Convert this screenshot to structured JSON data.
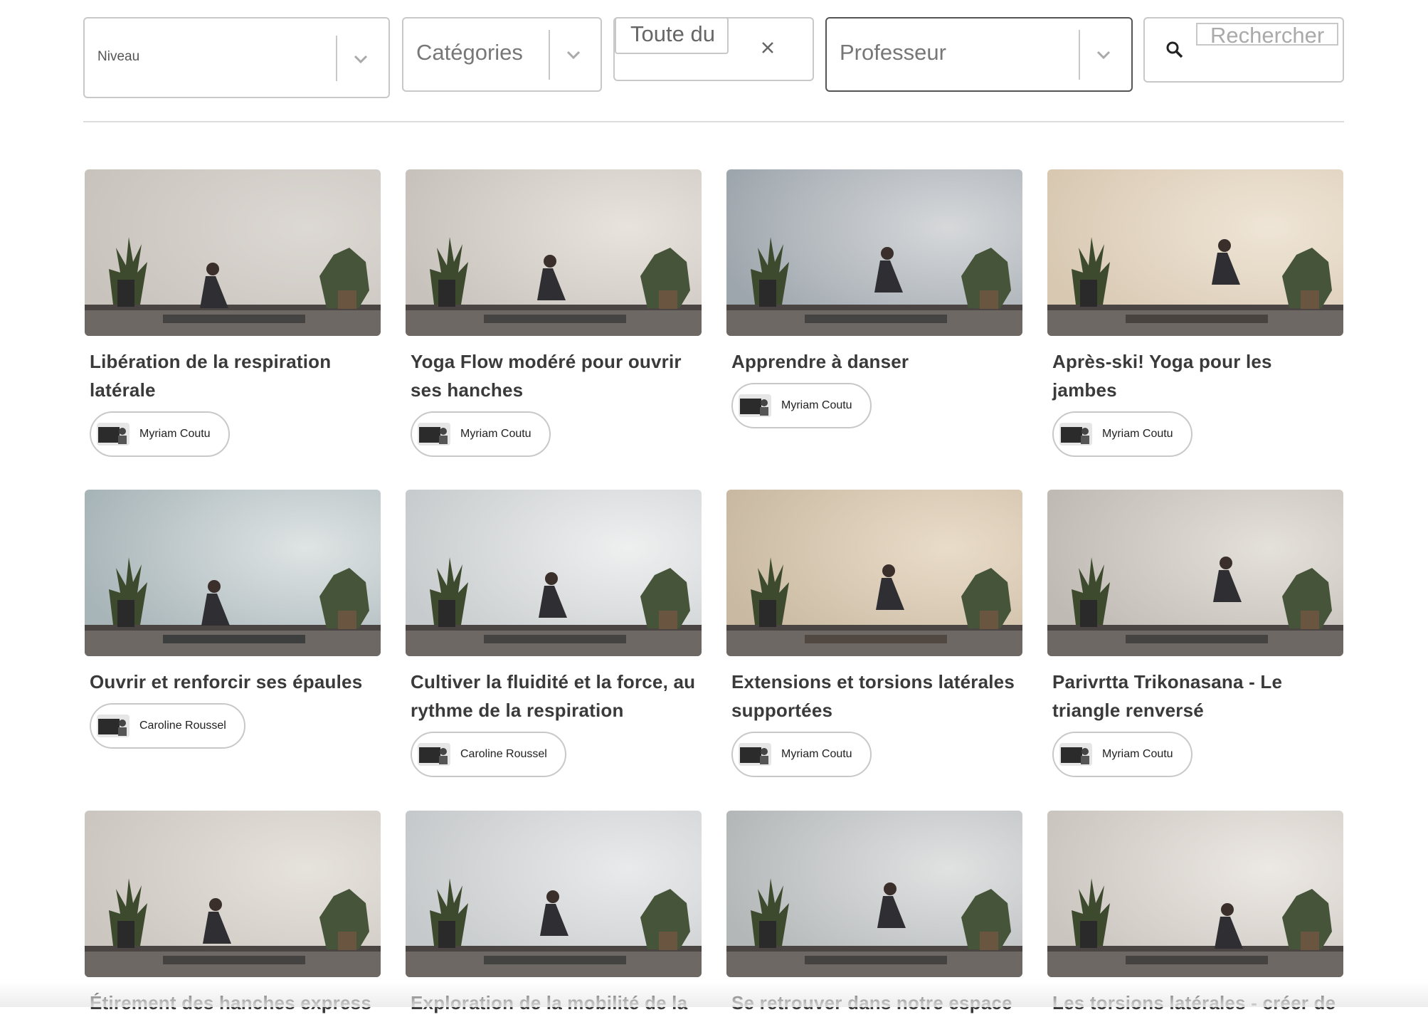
{
  "filters": {
    "niveau": "Niveau",
    "categories": "Catégories",
    "date": "Toute du",
    "professeur": "Professeur",
    "search_placeholder": "Rechercher"
  },
  "videos": [
    {
      "title": "Libération de la respiration latérale",
      "teacher": "Myriam Coutu"
    },
    {
      "title": "Yoga Flow modéré pour ouvrir ses hanches",
      "teacher": "Myriam Coutu"
    },
    {
      "title": "Apprendre à danser",
      "teacher": "Myriam Coutu"
    },
    {
      "title": "Après-ski! Yoga pour les jambes",
      "teacher": "Myriam Coutu"
    },
    {
      "title": "Ouvrir et renforcir ses épaules",
      "teacher": "Caroline Roussel"
    },
    {
      "title": "Cultiver la fluidité et la force, au rythme de la respiration",
      "teacher": "Caroline Roussel"
    },
    {
      "title": "Extensions et torsions latérales supportées",
      "teacher": "Myriam Coutu"
    },
    {
      "title": "Parivrtta Trikonasana - Le triangle renversé",
      "teacher": "Myriam Coutu"
    },
    {
      "title": "Étirement des hanches express",
      "teacher": ""
    },
    {
      "title": "Exploration de la mobilité de la",
      "teacher": ""
    },
    {
      "title": "Se retrouver dans notre espace",
      "teacher": ""
    },
    {
      "title": "Les torsions latérales - créer de",
      "teacher": ""
    }
  ]
}
